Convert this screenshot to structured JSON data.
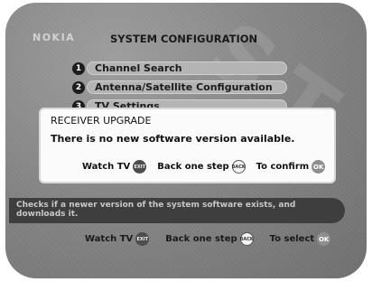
{
  "header": {
    "logo": "NOKIA",
    "title": "SYSTEM CONFIGURATION"
  },
  "menu": {
    "items": [
      {
        "number": "1",
        "label": "Channel Search"
      },
      {
        "number": "2",
        "label": "Antenna/Satellite Configuration"
      },
      {
        "number": "3",
        "label": "TV Settings"
      }
    ]
  },
  "dialog": {
    "title": "RECEIVER UPGRADE",
    "message": "There is no new software version available.",
    "watch_tv_label": "Watch TV",
    "watch_tv_key": "EXIT",
    "back_label": "Back one step",
    "back_key": "BACK",
    "confirm_label": "To confirm",
    "confirm_key": "OK"
  },
  "help": {
    "text": "Checks if a newer version of the system software exists, and downloads it."
  },
  "bottom_bar": {
    "watch_tv_label": "Watch TV",
    "watch_tv_key": "EXIT",
    "back_label": "Back one step",
    "back_key": "BACK",
    "select_label": "To select",
    "select_key": "OK"
  }
}
